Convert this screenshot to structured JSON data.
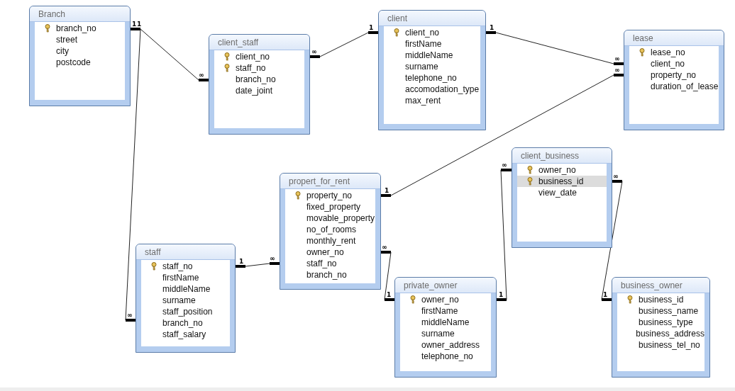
{
  "tables": [
    {
      "title": "Branch",
      "fields": [
        {
          "name": "branch_no",
          "key": true,
          "selected": false
        },
        {
          "name": "street",
          "key": false,
          "selected": false
        },
        {
          "name": "city",
          "key": false,
          "selected": false
        },
        {
          "name": "postcode",
          "key": false,
          "selected": false
        }
      ]
    },
    {
      "title": "client_staff",
      "fields": [
        {
          "name": "client_no",
          "key": true,
          "selected": false
        },
        {
          "name": "staff_no",
          "key": true,
          "selected": false
        },
        {
          "name": "branch_no",
          "key": false,
          "selected": false
        },
        {
          "name": "date_joint",
          "key": false,
          "selected": false
        }
      ]
    },
    {
      "title": "client",
      "fields": [
        {
          "name": "client_no",
          "key": true,
          "selected": false
        },
        {
          "name": "firstName",
          "key": false,
          "selected": false
        },
        {
          "name": "middleName",
          "key": false,
          "selected": false
        },
        {
          "name": "surname",
          "key": false,
          "selected": false
        },
        {
          "name": "telephone_no",
          "key": false,
          "selected": false
        },
        {
          "name": "accomodation_type",
          "key": false,
          "selected": false
        },
        {
          "name": "max_rent",
          "key": false,
          "selected": false
        }
      ]
    },
    {
      "title": "lease",
      "fields": [
        {
          "name": "lease_no",
          "key": true,
          "selected": false
        },
        {
          "name": "client_no",
          "key": false,
          "selected": false
        },
        {
          "name": "property_no",
          "key": false,
          "selected": false
        },
        {
          "name": "duration_of_lease",
          "key": false,
          "selected": false
        }
      ]
    },
    {
      "title": "propert_for_rent",
      "fields": [
        {
          "name": "property_no",
          "key": true,
          "selected": false
        },
        {
          "name": "fixed_property",
          "key": false,
          "selected": false
        },
        {
          "name": "movable_property",
          "key": false,
          "selected": false
        },
        {
          "name": "no_of_rooms",
          "key": false,
          "selected": false
        },
        {
          "name": "monthly_rent",
          "key": false,
          "selected": false
        },
        {
          "name": "owner_no",
          "key": false,
          "selected": false
        },
        {
          "name": "staff_no",
          "key": false,
          "selected": false
        },
        {
          "name": "branch_no",
          "key": false,
          "selected": false
        }
      ]
    },
    {
      "title": "client_business",
      "fields": [
        {
          "name": "owner_no",
          "key": true,
          "selected": false
        },
        {
          "name": "business_id",
          "key": true,
          "selected": true
        },
        {
          "name": "view_date",
          "key": false,
          "selected": false
        }
      ]
    },
    {
      "title": "staff",
      "fields": [
        {
          "name": "staff_no",
          "key": true,
          "selected": false
        },
        {
          "name": "firstName",
          "key": false,
          "selected": false
        },
        {
          "name": "middleName",
          "key": false,
          "selected": false
        },
        {
          "name": "surname",
          "key": false,
          "selected": false
        },
        {
          "name": "staff_position",
          "key": false,
          "selected": false
        },
        {
          "name": "branch_no",
          "key": false,
          "selected": false
        },
        {
          "name": "staff_salary",
          "key": false,
          "selected": false
        }
      ]
    },
    {
      "title": "private_owner",
      "fields": [
        {
          "name": "owner_no",
          "key": true,
          "selected": false
        },
        {
          "name": "firstName",
          "key": false,
          "selected": false
        },
        {
          "name": "middleName",
          "key": false,
          "selected": false
        },
        {
          "name": "surname",
          "key": false,
          "selected": false
        },
        {
          "name": "owner_address",
          "key": false,
          "selected": false
        },
        {
          "name": "telephone_no",
          "key": false,
          "selected": false
        }
      ]
    },
    {
      "title": "business_owner",
      "fields": [
        {
          "name": "business_id",
          "key": true,
          "selected": false
        },
        {
          "name": "business_name",
          "key": false,
          "selected": false
        },
        {
          "name": "business_type",
          "key": false,
          "selected": false
        },
        {
          "name": "business_address",
          "key": false,
          "selected": false
        },
        {
          "name": "business_tel_no",
          "key": false,
          "selected": false
        }
      ]
    }
  ],
  "relationships": [
    {
      "ends": [
        "1",
        "∞"
      ]
    },
    {
      "ends": [
        "1",
        "∞"
      ]
    },
    {
      "ends": [
        "∞",
        "1"
      ]
    },
    {
      "ends": [
        "1",
        "∞"
      ]
    },
    {
      "ends": [
        "1",
        "∞"
      ]
    },
    {
      "ends": [
        "1",
        "∞"
      ]
    },
    {
      "ends": [
        "∞",
        "1"
      ]
    },
    {
      "ends": [
        "1",
        "∞"
      ]
    },
    {
      "ends": [
        "∞",
        "1"
      ]
    }
  ]
}
